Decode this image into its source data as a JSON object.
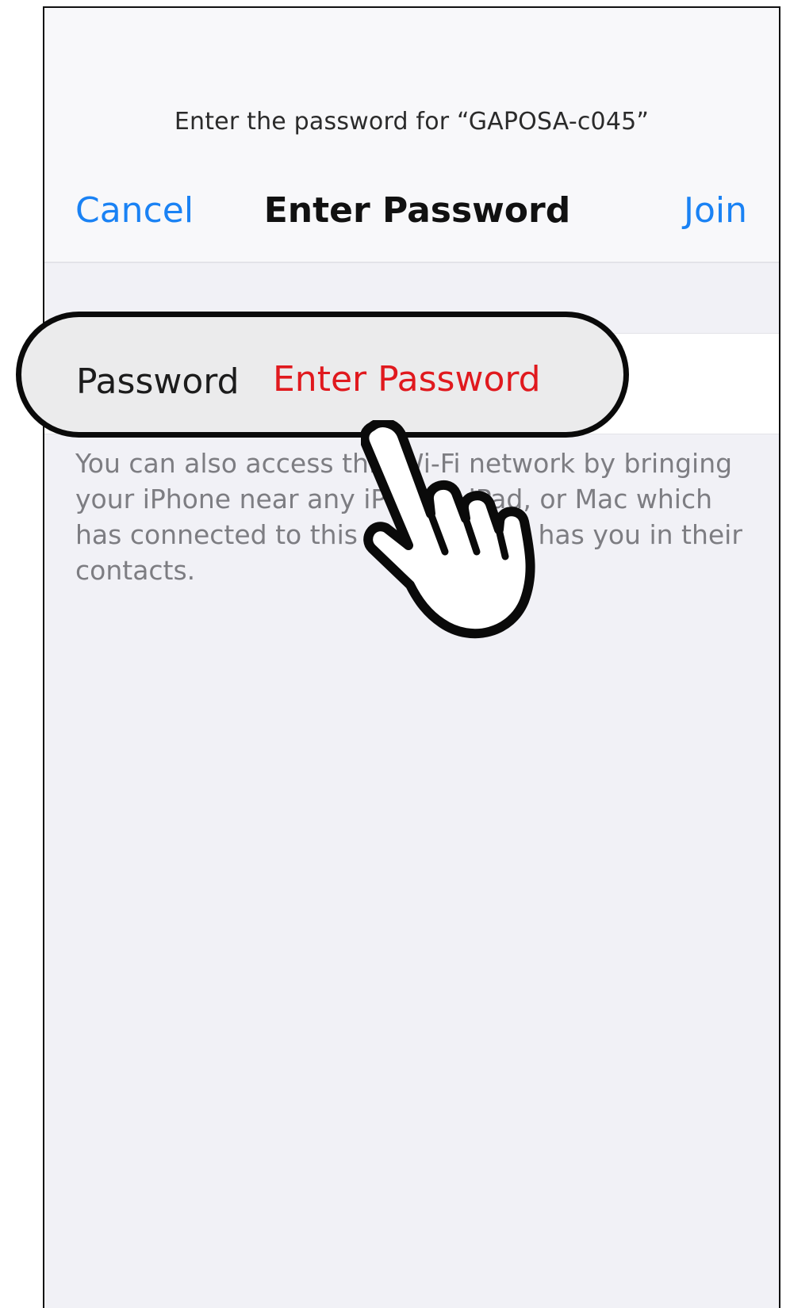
{
  "header": {
    "prompt": "Enter the password for “GAPOSA-c045”",
    "title": "Enter Password",
    "cancel_label": "Cancel",
    "join_label": "Join"
  },
  "password_field": {
    "label": "Password",
    "placeholder": "Enter Password",
    "value": ""
  },
  "footer": {
    "note": "You can also access this Wi-Fi network by bringing your iPhone near any iPhone, iPad, or Mac which has connected to this network and has you in their contacts."
  },
  "overlay": {
    "highlight": "password-row",
    "pointer_icon": "hand-pointer-icon"
  },
  "colors": {
    "accent": "#1a82f4",
    "placeholder": "#e0191e",
    "background": "#f1f1f6"
  }
}
